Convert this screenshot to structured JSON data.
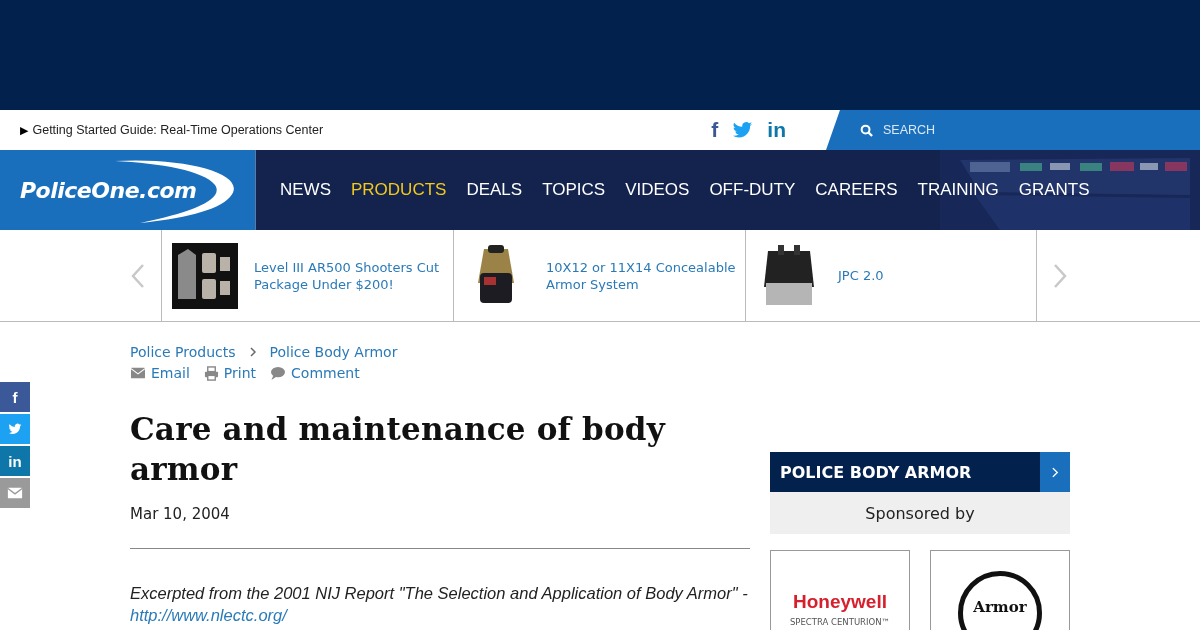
{
  "utility_bar": {
    "promo": {
      "marker": "▶",
      "text": "Getting Started Guide: Real-Time Operations Center"
    },
    "social": [
      {
        "kind": "facebook",
        "glyph": "f"
      },
      {
        "kind": "twitter"
      },
      {
        "kind": "linkedin",
        "glyph": "in"
      }
    ],
    "search": {
      "placeholder": "SEARCH"
    }
  },
  "header": {
    "logo": "PoliceOne.com",
    "nav": [
      {
        "label": "NEWS",
        "selected": false
      },
      {
        "label": "PRODUCTS",
        "selected": true
      },
      {
        "label": "DEALS",
        "selected": false
      },
      {
        "label": "TOPICS",
        "selected": false
      },
      {
        "label": "VIDEOS",
        "selected": false
      },
      {
        "label": "OFF-DUTY",
        "selected": false
      },
      {
        "label": "CAREERS",
        "selected": false
      },
      {
        "label": "TRAINING",
        "selected": false
      },
      {
        "label": "GRANTS",
        "selected": false
      }
    ]
  },
  "carousel": [
    {
      "title": "Level III AR500 Shooters Cut Package Under $200!"
    },
    {
      "title": "10X12 or 11X14 Concealable Armor System"
    },
    {
      "title": "JPC 2.0"
    }
  ],
  "share_rail": [
    {
      "kind": "facebook",
      "glyph": "f"
    },
    {
      "kind": "twitter"
    },
    {
      "kind": "linkedin",
      "glyph": "in"
    },
    {
      "kind": "email"
    }
  ],
  "article": {
    "breadcrumbs": [
      "Police Products",
      "Police Body Armor"
    ],
    "actions": [
      {
        "kind": "email",
        "label": "Email"
      },
      {
        "kind": "print",
        "label": "Print"
      },
      {
        "kind": "comment",
        "label": "Comment"
      }
    ],
    "title": "Care and maintenance of body armor",
    "date": "Mar 10, 2004",
    "intro": "Excerpted from the 2001 NIJ Report \"The Selection and Application of Body Armor\" -",
    "link": "http://www.nlectc.org/"
  },
  "sidebar": {
    "heading": "POLICE BODY ARMOR",
    "sponsored": "Sponsored by",
    "sponsors": [
      {
        "name": "Honeywell",
        "tagline": "SPECTRA CENTURION™"
      },
      {
        "name": "Armor"
      }
    ]
  }
}
